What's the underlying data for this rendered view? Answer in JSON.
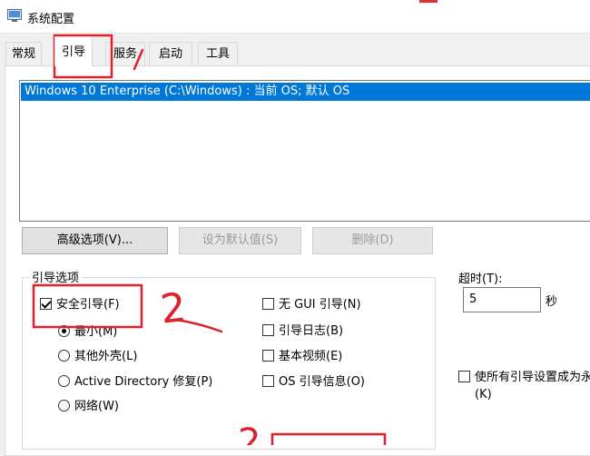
{
  "window": {
    "title": "系统配置"
  },
  "tabs": [
    {
      "label": "常规",
      "active": false
    },
    {
      "label": "引导",
      "active": true
    },
    {
      "label": "服务",
      "active": false
    },
    {
      "label": "启动",
      "active": false
    },
    {
      "label": "工具",
      "active": false
    }
  ],
  "os_list": {
    "items": [
      {
        "text": "Windows 10 Enterprise (C:\\Windows) : 当前 OS; 默认 OS",
        "selected": true
      }
    ]
  },
  "buttons": {
    "advanced": "高级选项(V)...",
    "set_default": "设为默认值(S)",
    "delete": "删除(D)"
  },
  "boot_options": {
    "legend": "引导选项",
    "safe_boot": {
      "label": "安全引导(F)",
      "checked": true
    },
    "minimal": {
      "label": "最小(M)",
      "checked": true
    },
    "alternate_shell": {
      "label": "其他外壳(L)",
      "checked": false
    },
    "ad_repair": {
      "label": "Active Directory 修复(P)",
      "checked": false
    },
    "network": {
      "label": "网络(W)",
      "checked": false
    },
    "no_gui": {
      "label": "无 GUI 引导(N)",
      "checked": false
    },
    "boot_log": {
      "label": "引导日志(B)",
      "checked": false
    },
    "base_video": {
      "label": "基本视频(E)",
      "checked": false
    },
    "os_boot_info": {
      "label": "OS 引导信息(O)",
      "checked": false
    }
  },
  "timeout": {
    "label": "超时(T):",
    "value": "5",
    "unit": "秒"
  },
  "make_permanent": {
    "label": "使所有引导设置成为永",
    "label2": "(K)",
    "checked": false
  },
  "annotations": {
    "step2": "2",
    "step2_partial": "2",
    "color": "#e0202a"
  }
}
